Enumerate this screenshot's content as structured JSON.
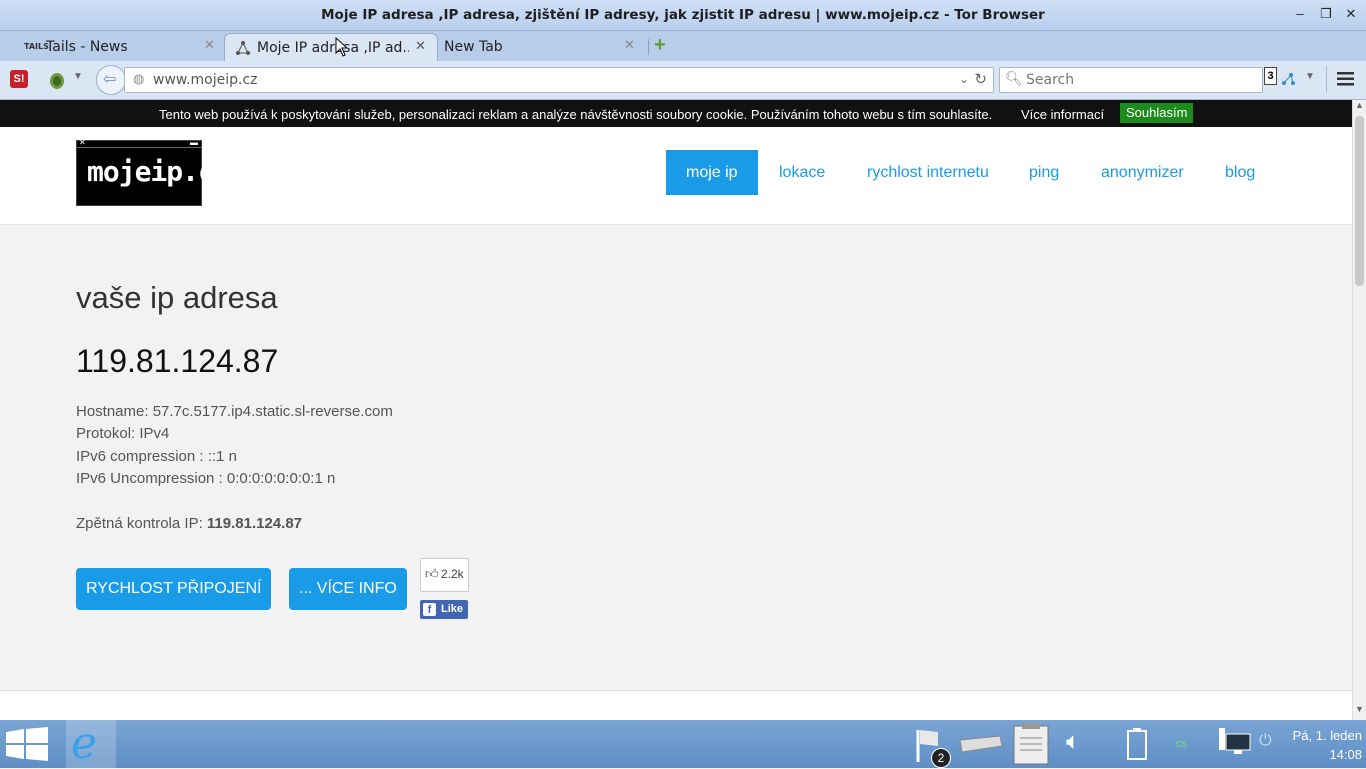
{
  "window": {
    "title": "Moje IP adresa ,IP adresa, zjištění IP adresy, jak zjistit IP adresu | www.mojeip.cz - Tor Browser"
  },
  "tabs": [
    {
      "label": "Tails - News",
      "icon_text": "TAILS"
    },
    {
      "label": "Moje IP adresa ,IP ad..."
    },
    {
      "label": "New Tab"
    }
  ],
  "navbar": {
    "url": "www.mojeip.cz",
    "search_placeholder": "Search",
    "badge": "3"
  },
  "cookie": {
    "text": "Tento web používá k poskytování služeb, personalizaci reklam a analýze návštěvnosti soubory cookie. Používáním tohoto webu s tím souhlasíte.",
    "more": "Více informací",
    "agree": "Souhlasím"
  },
  "site": {
    "logo": "mojeip.cz",
    "nav": [
      "moje ip",
      "lokace",
      "rychlost internetu",
      "ping",
      "anonymizer",
      "blog"
    ]
  },
  "main": {
    "heading": "vaše ip adresa",
    "ip": "119.81.124.87",
    "hostname": "Hostname: 57.7c.5177.ip4.static.sl-reverse.com",
    "protokol": "Protokol: IPv4",
    "ipv6_comp": "IPv6 compression : ::1 n",
    "ipv6_uncomp": "IPv6 Uncompression : 0:0:0:0:0:0:0:1 n",
    "reverse_label": "Zpětná kontrola IP: ",
    "reverse_value": "119.81.124.87",
    "btn_speed": "RYCHLOST PŘIPOJENÍ",
    "btn_more": "... VÍCE INFO",
    "fb_count": "2.2k",
    "fb_like": "Like"
  },
  "taskbar": {
    "notif_count": "2",
    "lang": "cs",
    "clock_day": "Pá,  1. leden",
    "clock_time": "14:08"
  }
}
